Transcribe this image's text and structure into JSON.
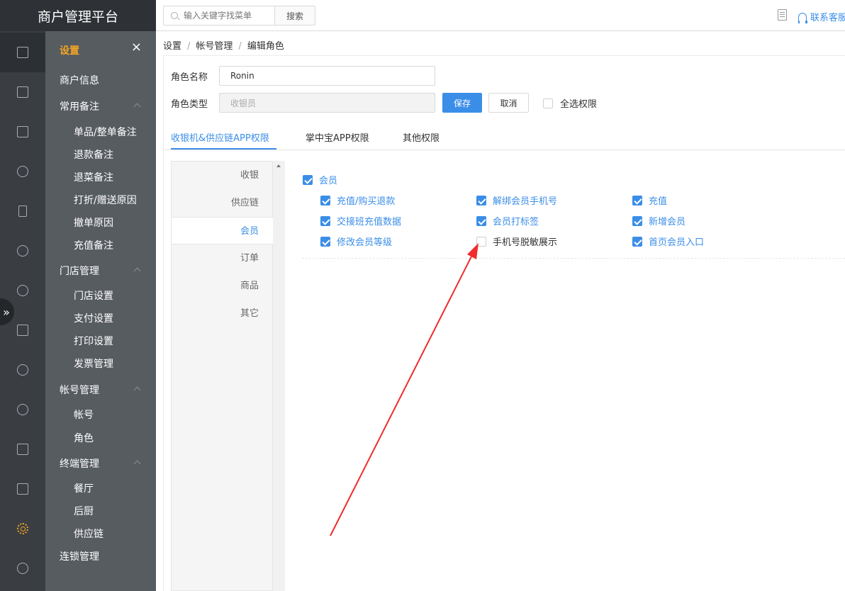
{
  "brand": "商户管理平台",
  "topbar": {
    "search_placeholder": "输入关键字找菜单",
    "search_button": "搜索",
    "contact": "联系客服"
  },
  "submenu": {
    "title": "设置",
    "close": "×",
    "items": [
      {
        "label": "商户信息",
        "level": 1
      },
      {
        "label": "常用备注",
        "level": 1,
        "group": true
      },
      {
        "label": "单品/整单备注",
        "level": 2
      },
      {
        "label": "退款备注",
        "level": 2
      },
      {
        "label": "退菜备注",
        "level": 2
      },
      {
        "label": "打折/赠送原因",
        "level": 2
      },
      {
        "label": "撤单原因",
        "level": 2
      },
      {
        "label": "充值备注",
        "level": 2
      },
      {
        "label": "门店管理",
        "level": 1,
        "group": true
      },
      {
        "label": "门店设置",
        "level": 2
      },
      {
        "label": "支付设置",
        "level": 2
      },
      {
        "label": "打印设置",
        "level": 2
      },
      {
        "label": "发票管理",
        "level": 2
      },
      {
        "label": "帐号管理",
        "level": 1,
        "group": true
      },
      {
        "label": "帐号",
        "level": 2
      },
      {
        "label": "角色",
        "level": 2
      },
      {
        "label": "终端管理",
        "level": 1,
        "group": true
      },
      {
        "label": "餐厅",
        "level": 2
      },
      {
        "label": "后厨",
        "level": 2
      },
      {
        "label": "供应链",
        "level": 2
      },
      {
        "label": "连锁管理",
        "level": 1
      }
    ]
  },
  "breadcrumb": [
    "设置",
    "帐号管理",
    "编辑角色"
  ],
  "form": {
    "name_label": "角色名称",
    "name_value": "Ronin",
    "type_label": "角色类型",
    "type_placeholder": "收银员",
    "save": "保存",
    "cancel": "取消",
    "select_all": "全选权限"
  },
  "tabs": [
    "收银机&供应链APP权限",
    "掌中宝APP权限",
    "其他权限"
  ],
  "categories": [
    "收银",
    "供应链",
    "会员",
    "订单",
    "商品",
    "其它"
  ],
  "permissions": {
    "group": "会员",
    "items": [
      {
        "label": "充值/购买退款",
        "checked": true
      },
      {
        "label": "解绑会员手机号",
        "checked": true
      },
      {
        "label": "充值",
        "checked": true
      },
      {
        "label": "交接班充值数据",
        "checked": true
      },
      {
        "label": "会员打标签",
        "checked": true
      },
      {
        "label": "新增会员",
        "checked": true
      },
      {
        "label": "修改会员等级",
        "checked": true
      },
      {
        "label": "手机号脱敏展示",
        "checked": false
      },
      {
        "label": "首页会员入口",
        "checked": true
      }
    ]
  },
  "colors": {
    "accent": "#3b8ee8",
    "highlight": "#f5a623",
    "annotation": "#f02c2c"
  }
}
